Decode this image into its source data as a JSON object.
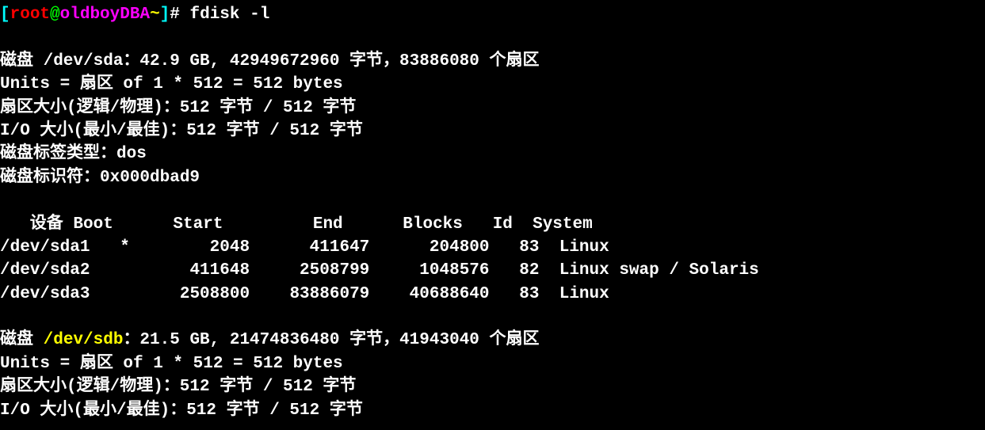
{
  "prompt": {
    "user": "root",
    "at": "@",
    "host": "oldboyDBA",
    "path": "~",
    "symbol": "# "
  },
  "command": "fdisk -l",
  "disk_sda": {
    "header": "磁盘 /dev/sda：42.9 GB, 42949672960 字节，83886080 个扇区",
    "units": "Units = 扇区 of 1 * 512 = 512 bytes",
    "sector_size": "扇区大小(逻辑/物理)：512 字节 / 512 字节",
    "io_size": "I/O 大小(最小/最佳)：512 字节 / 512 字节",
    "label_type": "磁盘标签类型：dos",
    "identifier": "磁盘标识符：0x000dbad9"
  },
  "partition_table": {
    "header": "   设备 Boot      Start         End      Blocks   Id  System",
    "rows": [
      "/dev/sda1   *        2048      411647      204800   83  Linux",
      "/dev/sda2          411648     2508799     1048576   82  Linux swap / Solaris",
      "/dev/sda3         2508800    83886079    40688640   83  Linux"
    ]
  },
  "disk_sdb": {
    "prefix": "磁盘 ",
    "device": "/dev/sdb",
    "suffix": "：21.5 GB, 21474836480 字节，41943040 个扇区",
    "units": "Units = 扇区 of 1 * 512 = 512 bytes",
    "sector_size": "扇区大小(逻辑/物理)：512 字节 / 512 字节",
    "io_size": "I/O 大小(最小/最佳)：512 字节 / 512 字节"
  }
}
